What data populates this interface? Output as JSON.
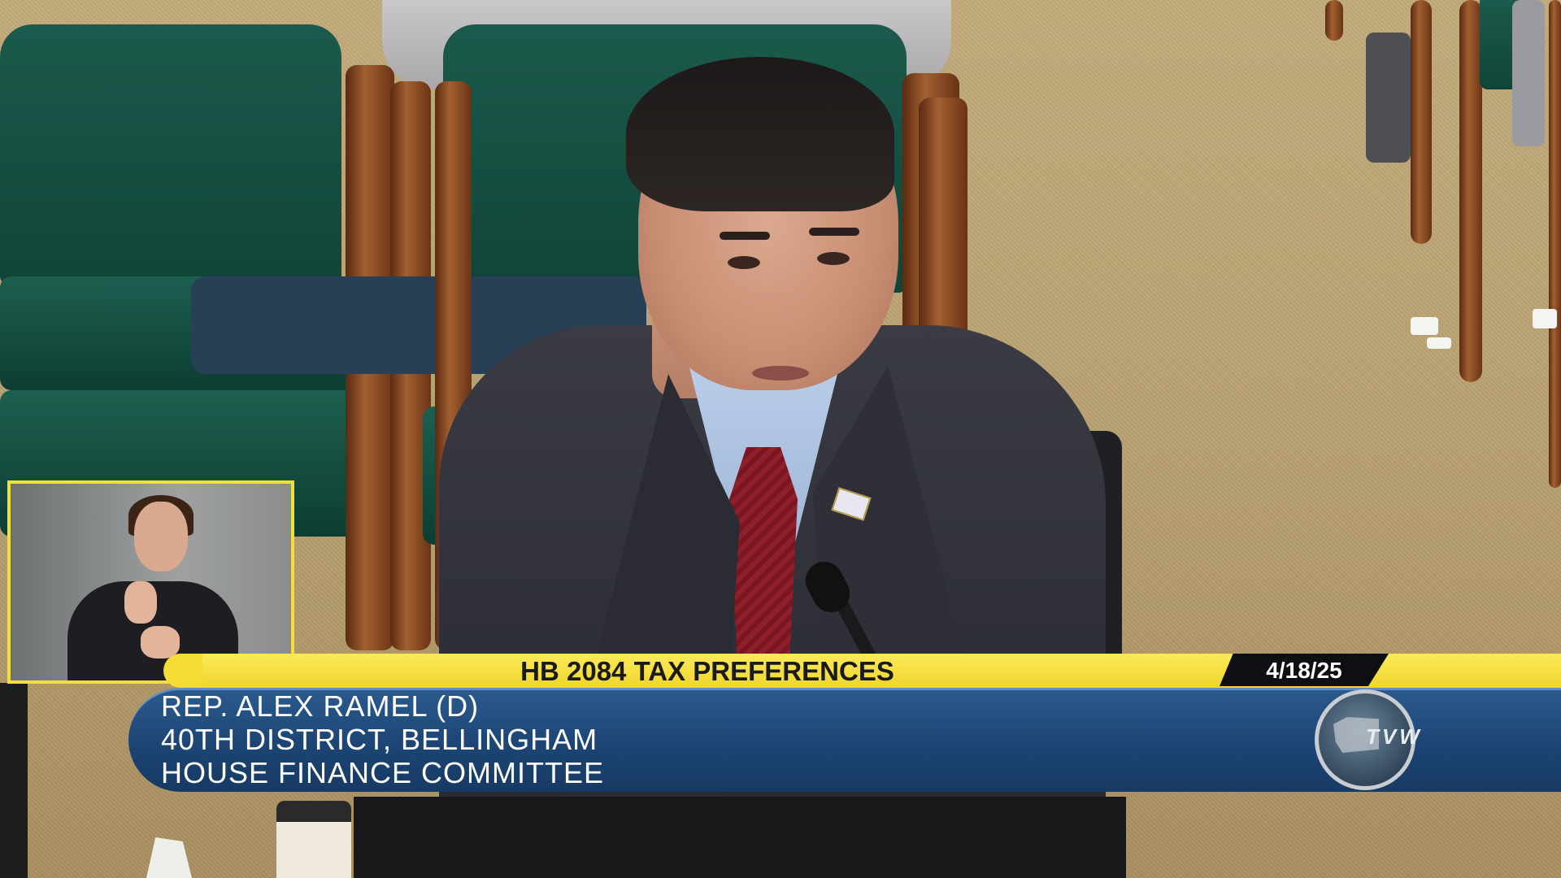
{
  "lower_third": {
    "bill_title": "HB 2084 TAX PREFERENCES",
    "date": "4/18/25",
    "speaker_name": "REP. ALEX RAMEL (D)",
    "district": "40TH DISTRICT, BELLINGHAM",
    "committee": "HOUSE FINANCE COMMITTEE"
  },
  "logo": {
    "text": "TVW"
  },
  "colors": {
    "banner_yellow": "#f0d72b",
    "banner_blue": "#1d4676",
    "chair_green": "#1b5a4c",
    "inset_border": "#f2df3a"
  }
}
